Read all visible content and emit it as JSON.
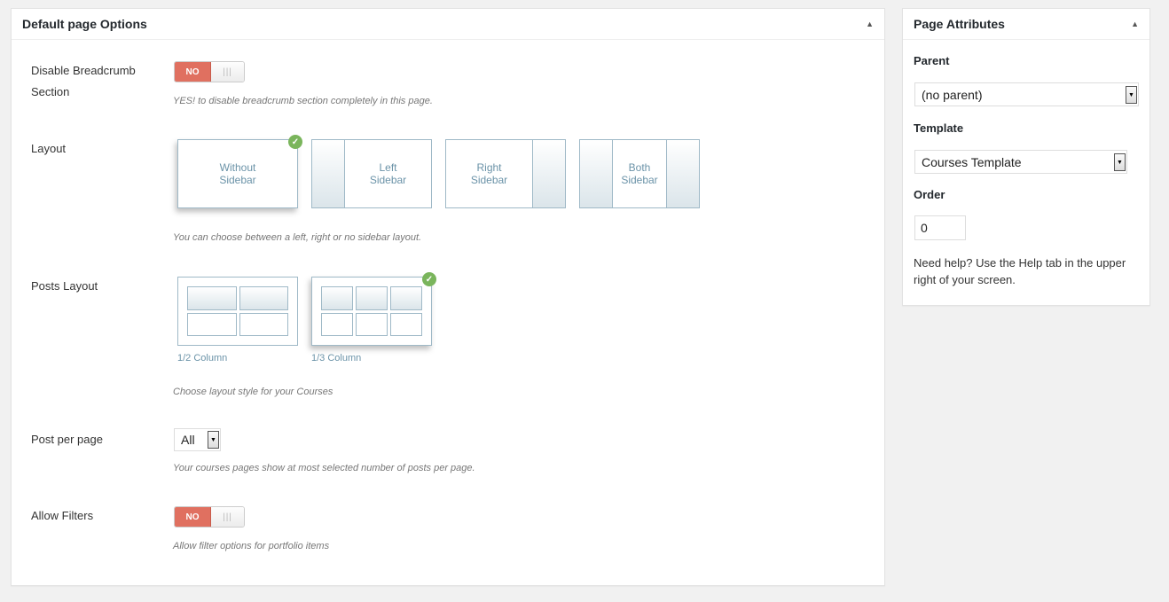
{
  "main_box": {
    "title": "Default page Options",
    "breadcrumb": {
      "label_line1": "Disable Breadcrumb",
      "label_line2": "Section",
      "switch_off_label": "NO",
      "switch_grip": "|||",
      "description": "YES! to disable breadcrumb section completely in this page."
    },
    "layout": {
      "label": "Layout",
      "options": [
        {
          "line1": "Without",
          "line2": "Sidebar",
          "selected": true
        },
        {
          "line1": "Left",
          "line2": "Sidebar",
          "selected": false
        },
        {
          "line1": "Right",
          "line2": "Sidebar",
          "selected": false
        },
        {
          "line1": "Both",
          "line2": "Sidebar",
          "selected": false
        }
      ],
      "description": "You can choose between a left, right or no sidebar layout."
    },
    "posts_layout": {
      "label": "Posts Layout",
      "options": [
        {
          "caption": "1/2 Column",
          "selected": false
        },
        {
          "caption": "1/3 Column",
          "selected": true
        }
      ],
      "description": "Choose layout style for your Courses"
    },
    "post_per_page": {
      "label": "Post per page",
      "value": "All",
      "description": "Your courses pages show at most selected number of posts per page."
    },
    "allow_filters": {
      "label": "Allow Filters",
      "switch_off_label": "NO",
      "switch_grip": "|||",
      "description": "Allow filter options for portfolio items"
    }
  },
  "side_box": {
    "title": "Page Attributes",
    "parent_label": "Parent",
    "parent_value": "(no parent)",
    "template_label": "Template",
    "template_value": "Courses Template",
    "order_label": "Order",
    "order_value": "0",
    "help_text": "Need help? Use the Help tab in the upper right of your screen."
  },
  "icons": {
    "collapse": "triangle-up-icon",
    "check": "checkmark-icon",
    "dropdown": "arrow-down-icon"
  },
  "colors": {
    "switch_off": "#e07060",
    "check": "#7ab55c",
    "layout_text": "#6b93a8"
  }
}
